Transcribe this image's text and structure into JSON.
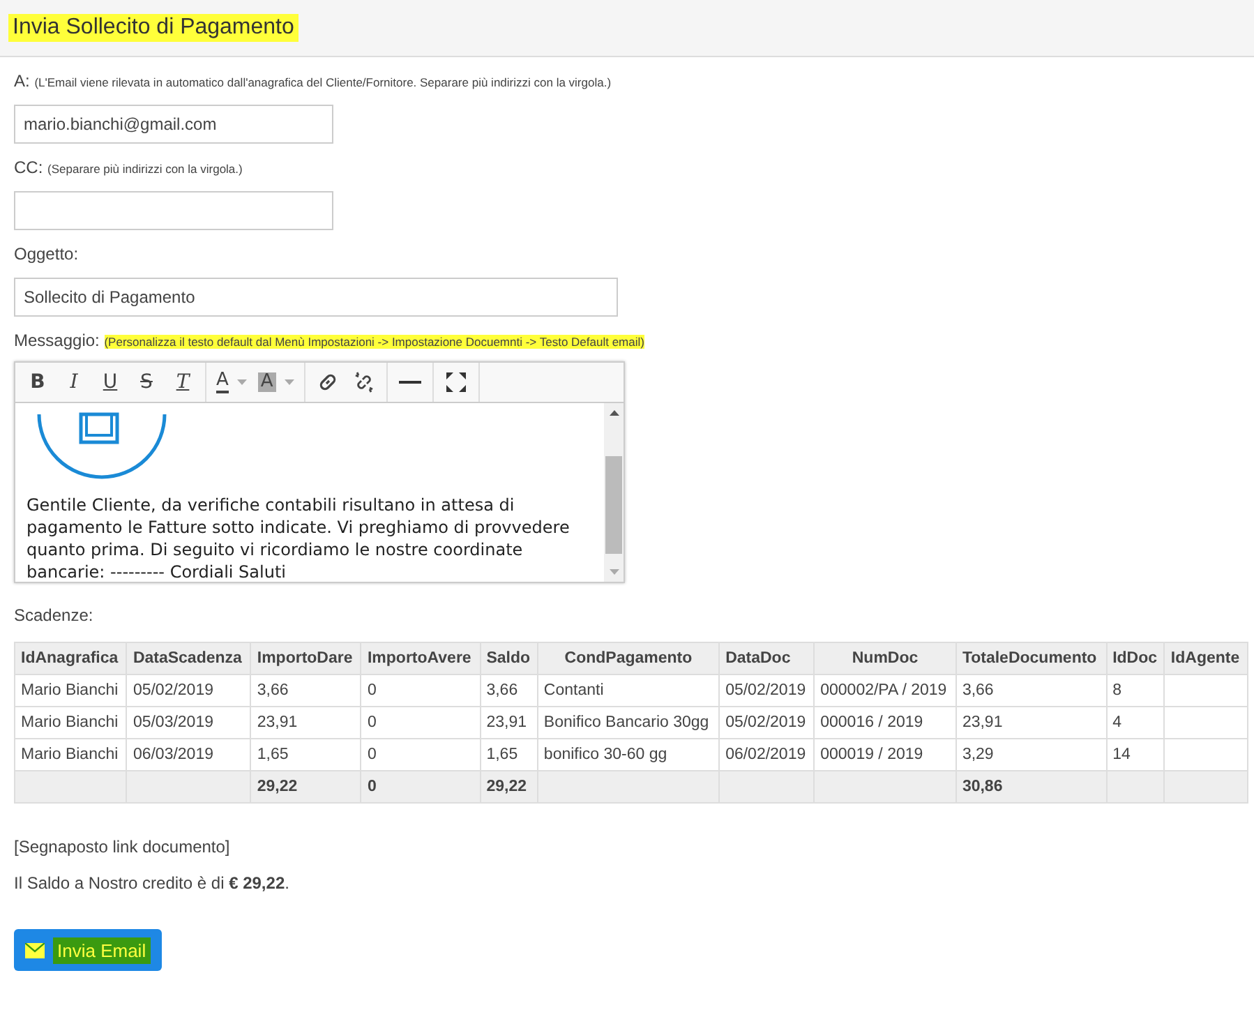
{
  "header": {
    "title": "Invia Sollecito di Pagamento"
  },
  "to": {
    "label": "A:",
    "hint": "(L'Email viene rilevata in automatico dall'anagrafica del Cliente/Fornitore. Separare più indirizzi con la virgola.)",
    "value": "mario.bianchi@gmail.com"
  },
  "cc": {
    "label": "CC:",
    "hint": "(Separare più indirizzi con la virgola.)"
  },
  "subject": {
    "label": "Oggetto:",
    "value": "Sollecito di Pagamento"
  },
  "message": {
    "label": "Messaggio:",
    "hint": "(Personalizza il testo default dal Menù Impostazioni -> Impostazione Docuemnti -> Testo Default email)",
    "toolbar": [
      [
        {
          "kind": "text",
          "label": "B"
        },
        {
          "kind": "text",
          "label": "I"
        },
        {
          "kind": "text",
          "label": "U"
        },
        {
          "kind": "text",
          "label": "S"
        },
        {
          "kind": "text",
          "label": "T"
        }
      ],
      [
        {
          "kind": "color",
          "label": "A"
        },
        {
          "kind": "bgcolor",
          "label": "A"
        }
      ],
      [
        {
          "kind": "link"
        },
        {
          "kind": "unlink"
        }
      ],
      [
        {
          "kind": "rule"
        }
      ],
      [
        {
          "kind": "maximize"
        }
      ]
    ],
    "body": "Gentile Cliente, da verifiche contabili risultano in attesa di pagamento le Fatture sotto indicate. Vi preghiamo di provvedere quanto prima. Di seguito vi ricordiamo le nostre coordinate bancarie: --------- Cordiali Saluti"
  },
  "due": {
    "label": "Scadenze:",
    "columns": [
      "IdAnagrafica",
      "DataScadenza",
      "ImportoDare",
      "ImportoAvere",
      "Saldo",
      "CondPagamento",
      "DataDoc",
      "NumDoc",
      "TotaleDocumento",
      "IdDoc",
      "IdAgente"
    ],
    "rows": [
      [
        "Mario Bianchi",
        "05/02/2019",
        "3,66",
        "0",
        "3,66",
        "Contanti",
        "05/02/2019",
        "000002/PA / 2019",
        "3,66",
        "8",
        ""
      ],
      [
        "Mario Bianchi",
        "05/03/2019",
        "23,91",
        "0",
        "23,91",
        "Bonifico Bancario 30gg",
        "05/02/2019",
        "000016 / 2019",
        "23,91",
        "4",
        ""
      ],
      [
        "Mario Bianchi",
        "06/03/2019",
        "1,65",
        "0",
        "1,65",
        "bonifico 30-60 gg",
        "06/02/2019",
        "000019 / 2019",
        "3,29",
        "14",
        ""
      ]
    ],
    "totals": {
      "importo_dare": "29,22",
      "importo_avere": "0",
      "saldo": "29,22",
      "totale_documento": "30,86"
    }
  },
  "placeholder_link": "[Segnaposto link documento]",
  "balance": "Il Saldo a Nostro credito è di **€ 29,22**.",
  "send_button": "Invia Email"
}
